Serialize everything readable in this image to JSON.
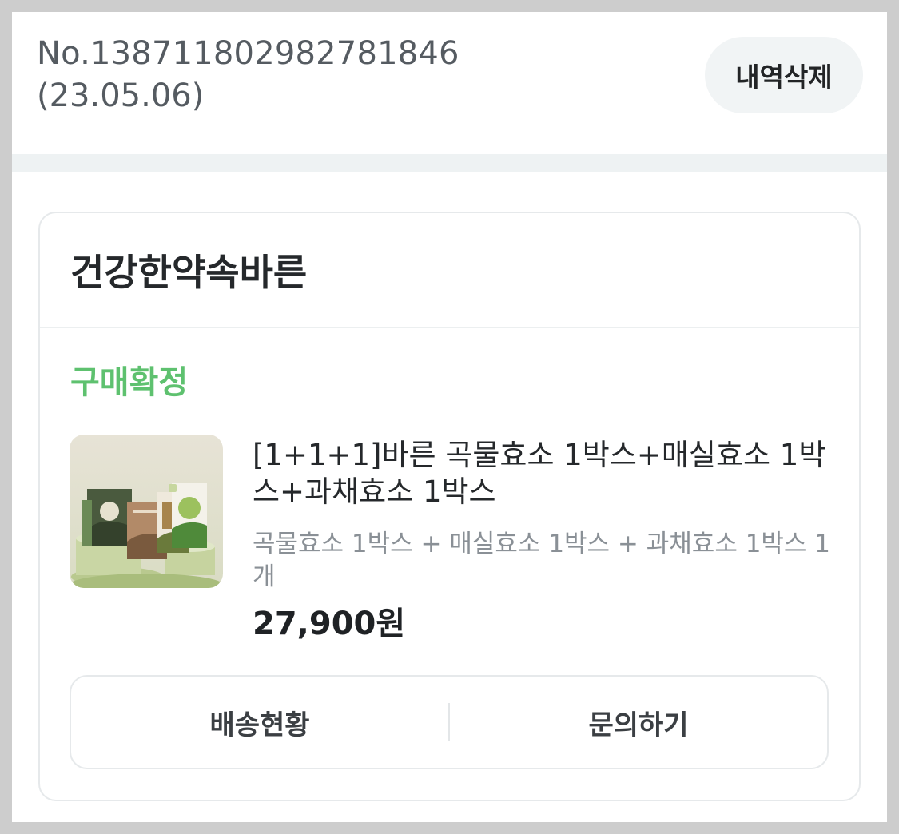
{
  "order": {
    "number": "No.138711802982781846",
    "date": "(23.05.06)",
    "delete_label": "내역삭제"
  },
  "store": {
    "name": "건강한약속바른",
    "status": "구매확정",
    "status_color": "#5ec16f"
  },
  "product": {
    "image_icon": "product-package-image",
    "title": "[1+1+1]바른 곡물효소 1박스+매실효소 1박스+과채효소 1박스",
    "option": "곡물효소 1박스 + 매실효소 1박스 + 과채효소 1박스 1개",
    "price": "27,900원"
  },
  "actions": {
    "delivery_label": "배송현황",
    "inquiry_label": "문의하기"
  }
}
